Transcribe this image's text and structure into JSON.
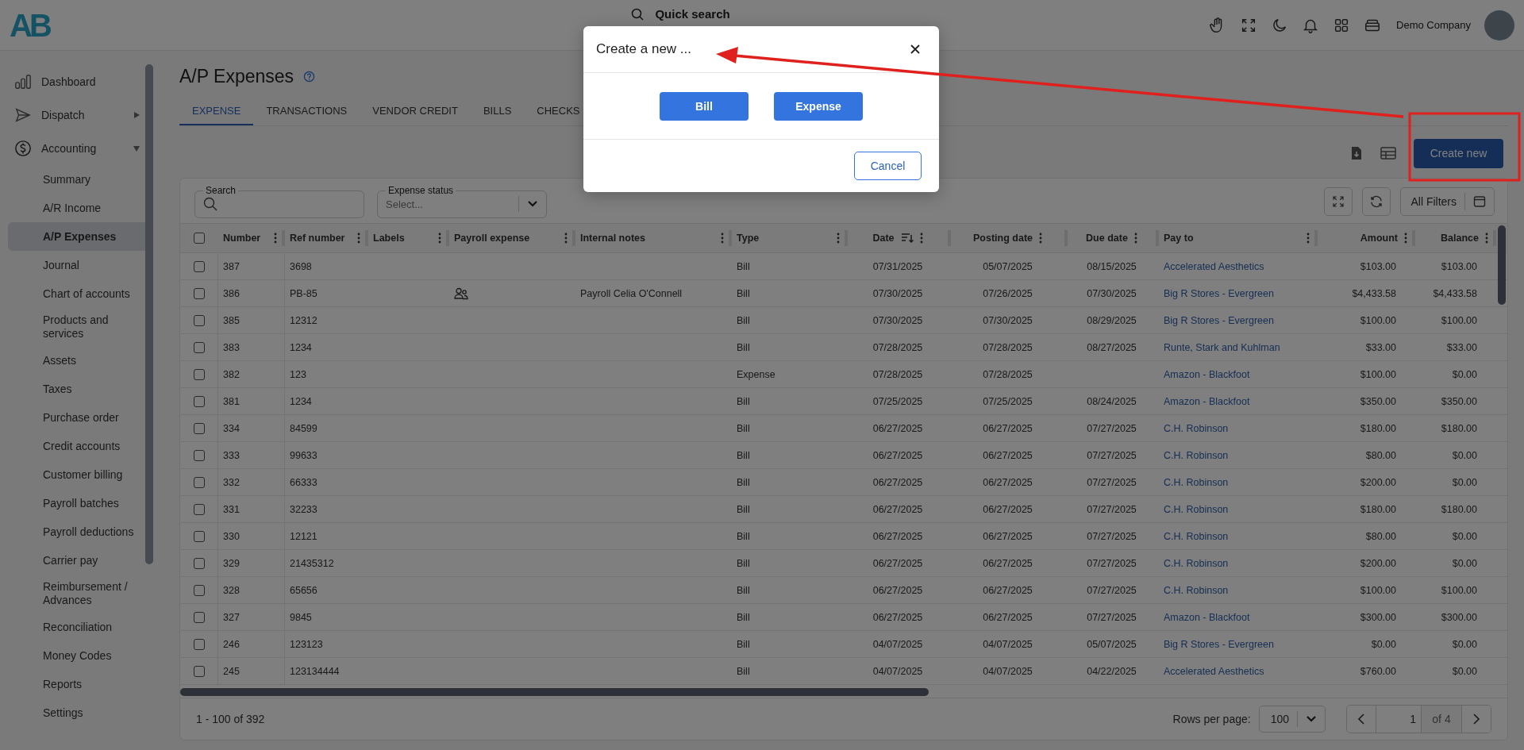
{
  "header": {
    "logo": "AB",
    "quick_search": "Quick search",
    "company": "Demo Company"
  },
  "sidebar": {
    "items": [
      {
        "label": "Dashboard",
        "selected": false
      },
      {
        "label": "Dispatch",
        "selected": false,
        "expanded": false
      },
      {
        "label": "Accounting",
        "selected": false,
        "expanded": true,
        "children": [
          {
            "label": "Summary",
            "selected": false
          },
          {
            "label": "A/R Income",
            "selected": false
          },
          {
            "label": "A/P Expenses",
            "selected": true
          },
          {
            "label": "Journal",
            "selected": false
          },
          {
            "label": "Chart of accounts",
            "selected": false
          },
          {
            "label": "Products and services",
            "selected": false
          },
          {
            "label": "Assets",
            "selected": false
          },
          {
            "label": "Taxes",
            "selected": false
          },
          {
            "label": "Purchase order",
            "selected": false
          },
          {
            "label": "Credit accounts",
            "selected": false
          },
          {
            "label": "Customer billing",
            "selected": false
          },
          {
            "label": "Payroll batches",
            "selected": false
          },
          {
            "label": "Payroll deductions",
            "selected": false
          },
          {
            "label": "Carrier pay",
            "selected": false
          },
          {
            "label": "Reimbursement / Advances",
            "selected": false
          },
          {
            "label": "Reconciliation",
            "selected": false
          },
          {
            "label": "Money Codes",
            "selected": false
          },
          {
            "label": "Reports",
            "selected": false
          },
          {
            "label": "Settings",
            "selected": false
          }
        ]
      }
    ]
  },
  "page": {
    "title": "A/P Expenses",
    "create_button": "Create new"
  },
  "tabs": [
    {
      "label": "EXPENSE",
      "selected": true
    },
    {
      "label": "TRANSACTIONS",
      "selected": false
    },
    {
      "label": "VENDOR CREDIT",
      "selected": false
    },
    {
      "label": "BILLS",
      "selected": false
    },
    {
      "label": "CHECKS",
      "selected": false
    }
  ],
  "filters": {
    "search_label": "Search",
    "status_label": "Expense status",
    "status_placeholder": "Select...",
    "all_filters": "All Filters"
  },
  "table": {
    "all_checked": false,
    "columns": [
      {
        "label": "Number",
        "sorted": false
      },
      {
        "label": "Ref number",
        "sorted": false
      },
      {
        "label": "Labels",
        "sorted": false
      },
      {
        "label": "Payroll expense",
        "sorted": false
      },
      {
        "label": "Internal notes",
        "sorted": false
      },
      {
        "label": "Type",
        "sorted": false
      },
      {
        "label": "Date",
        "sorted": true
      },
      {
        "label": "Posting date",
        "sorted": false
      },
      {
        "label": "Due date",
        "sorted": false
      },
      {
        "label": "Pay to",
        "sorted": false
      },
      {
        "label": "Amount",
        "sorted": false
      },
      {
        "label": "Balance",
        "sorted": false
      }
    ],
    "rows": [
      {
        "checked": false,
        "number": "387",
        "ref": "3698",
        "payroll": false,
        "notes": "",
        "type": "Bill",
        "date": "07/31/2025",
        "posting": "05/07/2025",
        "due": "08/15/2025",
        "pay_to": "Accelerated Aesthetics",
        "amount": "$103.00",
        "balance": "$103.00"
      },
      {
        "checked": false,
        "number": "386",
        "ref": "PB-85",
        "payroll": true,
        "notes": "Payroll Celia O'Connell",
        "type": "Bill",
        "date": "07/30/2025",
        "posting": "07/26/2025",
        "due": "07/30/2025",
        "pay_to": "Big R Stores - Evergreen",
        "amount": "$4,433.58",
        "balance": "$4,433.58"
      },
      {
        "checked": false,
        "number": "385",
        "ref": "12312",
        "payroll": false,
        "notes": "",
        "type": "Bill",
        "date": "07/30/2025",
        "posting": "07/30/2025",
        "due": "08/29/2025",
        "pay_to": "Big R Stores - Evergreen",
        "amount": "$100.00",
        "balance": "$100.00"
      },
      {
        "checked": false,
        "number": "383",
        "ref": "1234",
        "payroll": false,
        "notes": "",
        "type": "Bill",
        "date": "07/28/2025",
        "posting": "07/28/2025",
        "due": "08/27/2025",
        "pay_to": "Runte, Stark and Kuhlman",
        "amount": "$33.00",
        "balance": "$33.00"
      },
      {
        "checked": false,
        "number": "382",
        "ref": "123",
        "payroll": false,
        "notes": "",
        "type": "Expense",
        "date": "07/28/2025",
        "posting": "07/28/2025",
        "due": "",
        "pay_to": "Amazon - Blackfoot",
        "amount": "$100.00",
        "balance": "$0.00"
      },
      {
        "checked": false,
        "number": "381",
        "ref": "1234",
        "payroll": false,
        "notes": "",
        "type": "Bill",
        "date": "07/25/2025",
        "posting": "07/25/2025",
        "due": "08/24/2025",
        "pay_to": "Amazon - Blackfoot",
        "amount": "$350.00",
        "balance": "$350.00"
      },
      {
        "checked": false,
        "number": "334",
        "ref": "84599",
        "payroll": false,
        "notes": "",
        "type": "Bill",
        "date": "06/27/2025",
        "posting": "06/27/2025",
        "due": "07/27/2025",
        "pay_to": "C.H. Robinson",
        "amount": "$180.00",
        "balance": "$180.00"
      },
      {
        "checked": false,
        "number": "333",
        "ref": "99633",
        "payroll": false,
        "notes": "",
        "type": "Bill",
        "date": "06/27/2025",
        "posting": "06/27/2025",
        "due": "07/27/2025",
        "pay_to": "C.H. Robinson",
        "amount": "$80.00",
        "balance": "$0.00"
      },
      {
        "checked": false,
        "number": "332",
        "ref": "66333",
        "payroll": false,
        "notes": "",
        "type": "Bill",
        "date": "06/27/2025",
        "posting": "06/27/2025",
        "due": "07/27/2025",
        "pay_to": "C.H. Robinson",
        "amount": "$200.00",
        "balance": "$0.00"
      },
      {
        "checked": false,
        "number": "331",
        "ref": "32233",
        "payroll": false,
        "notes": "",
        "type": "Bill",
        "date": "06/27/2025",
        "posting": "06/27/2025",
        "due": "07/27/2025",
        "pay_to": "C.H. Robinson",
        "amount": "$180.00",
        "balance": "$180.00"
      },
      {
        "checked": false,
        "number": "330",
        "ref": "12121",
        "payroll": false,
        "notes": "",
        "type": "Bill",
        "date": "06/27/2025",
        "posting": "06/27/2025",
        "due": "07/27/2025",
        "pay_to": "C.H. Robinson",
        "amount": "$80.00",
        "balance": "$0.00"
      },
      {
        "checked": false,
        "number": "329",
        "ref": "21435312",
        "payroll": false,
        "notes": "",
        "type": "Bill",
        "date": "06/27/2025",
        "posting": "06/27/2025",
        "due": "07/27/2025",
        "pay_to": "C.H. Robinson",
        "amount": "$200.00",
        "balance": "$0.00"
      },
      {
        "checked": false,
        "number": "328",
        "ref": "65656",
        "payroll": false,
        "notes": "",
        "type": "Bill",
        "date": "06/27/2025",
        "posting": "06/27/2025",
        "due": "07/27/2025",
        "pay_to": "C.H. Robinson",
        "amount": "$100.00",
        "balance": "$100.00"
      },
      {
        "checked": false,
        "number": "327",
        "ref": "9845",
        "payroll": false,
        "notes": "",
        "type": "Bill",
        "date": "06/27/2025",
        "posting": "06/27/2025",
        "due": "07/27/2025",
        "pay_to": "Amazon - Blackfoot",
        "amount": "$300.00",
        "balance": "$300.00"
      },
      {
        "checked": false,
        "number": "246",
        "ref": "123123",
        "payroll": false,
        "notes": "",
        "type": "Bill",
        "date": "04/07/2025",
        "posting": "04/07/2025",
        "due": "05/07/2025",
        "pay_to": "Big R Stores - Evergreen",
        "amount": "$0.00",
        "balance": "$0.00"
      },
      {
        "checked": false,
        "number": "245",
        "ref": "123134444",
        "payroll": false,
        "notes": "",
        "type": "Bill",
        "date": "04/07/2025",
        "posting": "04/07/2025",
        "due": "04/22/2025",
        "pay_to": "Accelerated Aesthetics",
        "amount": "$760.00",
        "balance": "$0.00"
      }
    ]
  },
  "footer": {
    "range": "1 - 100 of 392",
    "rows_label": "Rows per page:",
    "rows_value": "100",
    "page": "1",
    "of_pages": "of 4"
  },
  "modal": {
    "title": "Create a new ...",
    "options": [
      "Bill",
      "Expense"
    ],
    "cancel": "Cancel"
  }
}
